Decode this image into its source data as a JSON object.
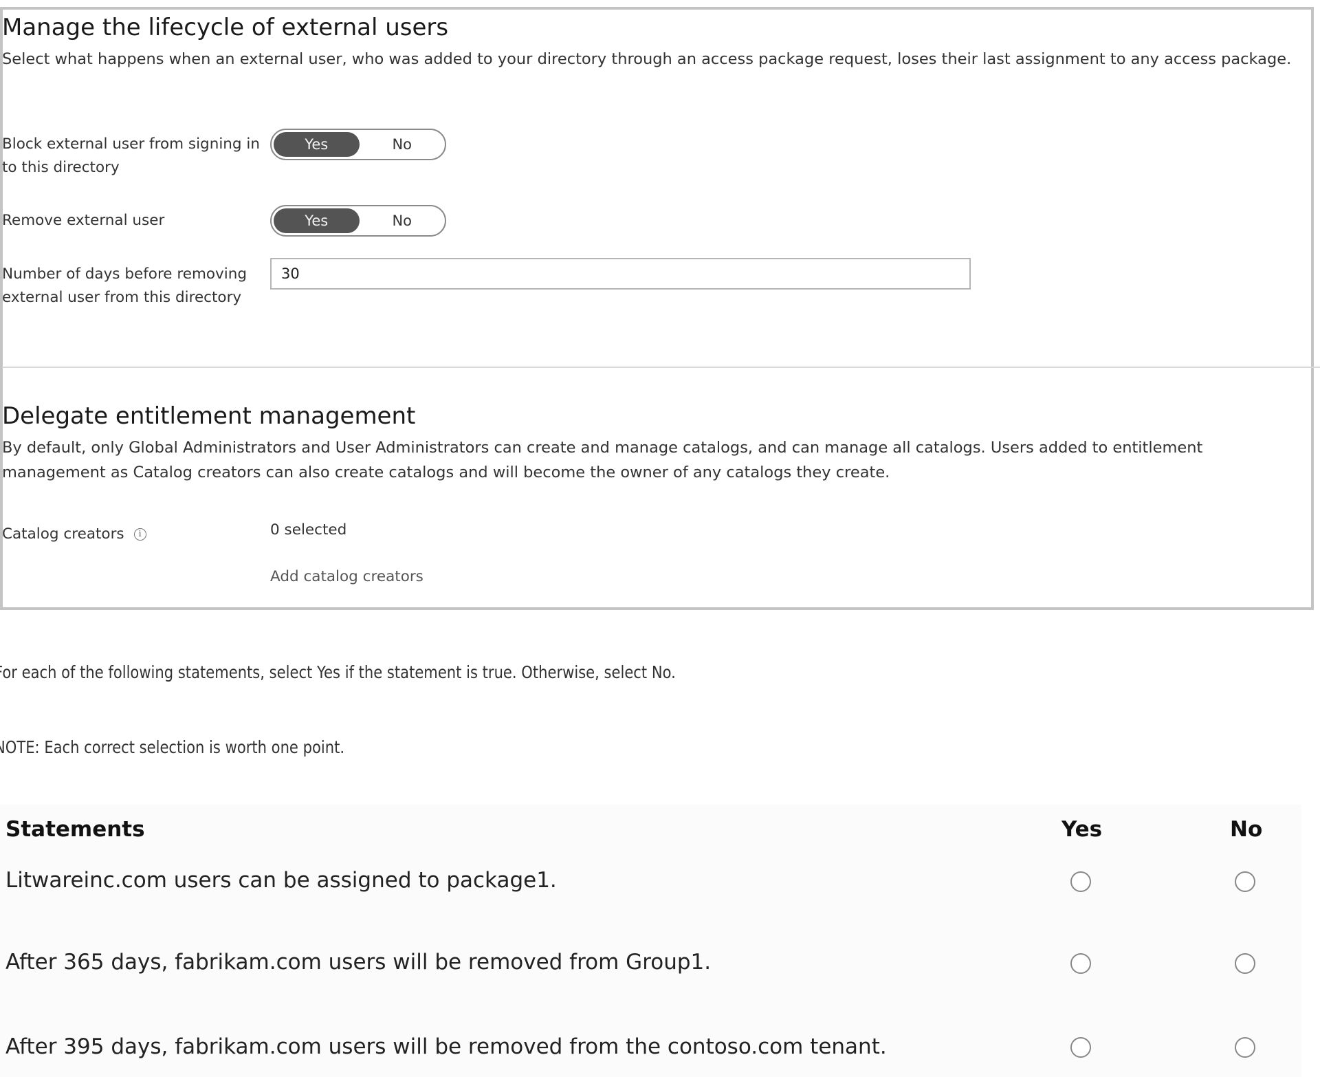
{
  "lifecycle": {
    "title": "Manage the lifecycle of external users",
    "description": "Select what happens when an external user, who was added to your directory through an access package request, loses their last assignment to any access package.",
    "block_label": "Block external user from signing in to this directory",
    "block_toggle": {
      "yes": "Yes",
      "no": "No",
      "selected": "Yes"
    },
    "remove_label": "Remove external user",
    "remove_toggle": {
      "yes": "Yes",
      "no": "No",
      "selected": "Yes"
    },
    "days_label": "Number of days before removing external user from this directory",
    "days_value": "30"
  },
  "delegate": {
    "title": "Delegate entitlement management",
    "description": "By default, only Global Administrators and User Administrators can create and manage catalogs, and can manage all catalogs. Users added to entitlement management as Catalog creators can also create catalogs and will become the owner of any catalogs they create.",
    "catalog_creators_label": "Catalog creators",
    "info_icon": "info-icon",
    "selected_text": "0 selected",
    "add_link": "Add catalog creators"
  },
  "instructions": {
    "line1": "For each of the following statements, select Yes if the statement is true. Otherwise, select No.",
    "line2": "NOTE: Each correct selection is worth one point."
  },
  "statements": {
    "header": "Statements",
    "yes_header": "Yes",
    "no_header": "No",
    "rows": [
      {
        "text": "Litwareinc.com users can be assigned to package1."
      },
      {
        "text": "After 365 days, fabrikam.com users will be removed from Group1."
      },
      {
        "text": "After 395 days, fabrikam.com users will be removed from the contoso.com tenant."
      }
    ]
  }
}
